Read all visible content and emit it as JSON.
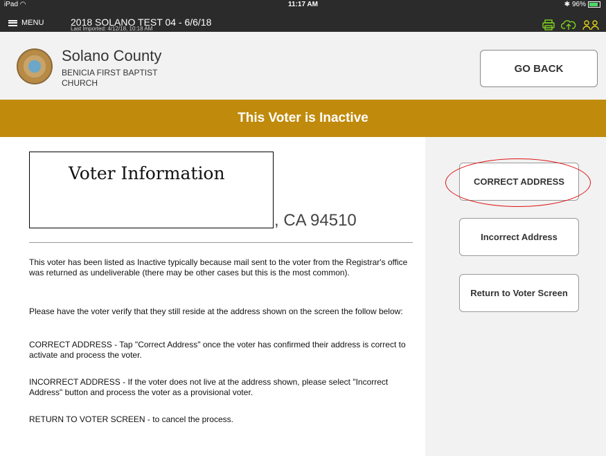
{
  "status_bar": {
    "device": "iPad",
    "time": "11:17 AM",
    "battery": "96%"
  },
  "nav": {
    "menu_label": "MENU",
    "election_title": "2018 SOLANO TEST 04 - 6/6/18",
    "last_imported": "Last Imported: 4/12/18, 10:18 AM",
    "icons": [
      "printer-icon",
      "cloud-upload-icon",
      "users-icon"
    ],
    "icon_color": "#7fd321"
  },
  "header": {
    "county": "Solano County",
    "polling_place": "BENICIA FIRST BAPTIST CHURCH",
    "go_back_label": "GO BACK"
  },
  "banner": {
    "text": "This Voter is Inactive",
    "color": "#c08a0c"
  },
  "voter": {
    "title": "Voter Information",
    "city_state_zip": ", CA 94510"
  },
  "instructions": [
    "This voter has been listed as Inactive typically because mail sent to the voter from the Registrar's office was returned as undeliverable (there may be other cases but this is the most common).",
    "Please have the voter verify that they still reside at the address shown on the screen the follow below:",
    "CORRECT ADDRESS -  Tap \"Correct Address\" once the voter has confirmed their address is correct to activate and process the voter.",
    "INCORRECT ADDRESS - If the voter does not live at the address shown, please select \"Incorrect Address\"  button and process the voter as a provisional voter.",
    "RETURN TO VOTER SCREEN - to cancel the process."
  ],
  "actions": {
    "correct_address": "CORRECT ADDRESS",
    "incorrect_address": "Incorrect Address",
    "return_to_voter": "Return to Voter Screen"
  }
}
